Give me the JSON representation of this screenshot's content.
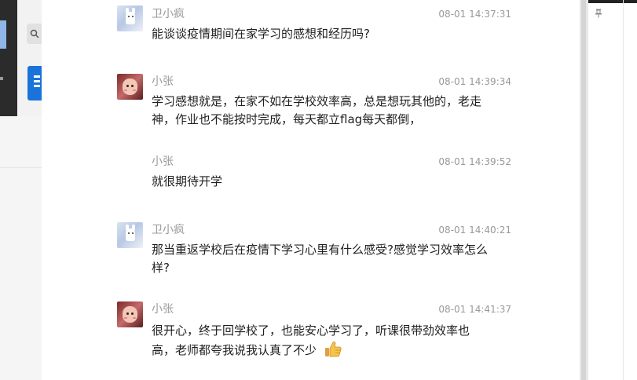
{
  "chat": {
    "messages": [
      {
        "sender": "卫小疯",
        "time": "08-01 14:37:31",
        "text": "能谈谈疫情期间在家学习的感想和经历吗?",
        "avatar": "ghost-avatar"
      },
      {
        "sender": "小张",
        "time": "08-01 14:39:34",
        "text": "学习感想就是，在家不如在学校效率高，总是想玩其他的，老走神，作业也不能按时完成，每天都立flag每天都倒，",
        "avatar": "girl-avatar"
      },
      {
        "sender": "小张",
        "time": "08-01 14:39:52",
        "text": "就很期待开学"
      },
      {
        "sender": "卫小疯",
        "time": "08-01 14:40:21",
        "text": "那当重返学校后在疫情下学习心里有什么感受?感觉学习效率怎么样?",
        "avatar": "ghost-avatar"
      },
      {
        "sender": "小张",
        "time": "08-01 14:41:37",
        "text": "很开心，终于回学校了，也能安心学习了，听课很带劲效率也高，老师都夸我说我认真了不少",
        "avatar": "girl-avatar",
        "emoji": "thumbs-up-icon"
      }
    ]
  },
  "colors": {
    "sender": "#999999",
    "text": "#1f1f1f",
    "accent": "#1a73d9"
  }
}
